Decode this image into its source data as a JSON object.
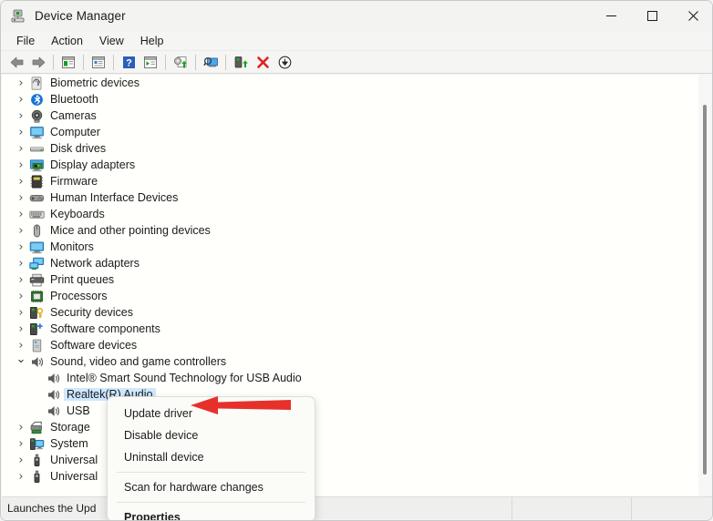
{
  "window": {
    "title": "Device Manager",
    "icon": "device-manager-icon",
    "controls": {
      "minimize": "—",
      "maximize": "☐",
      "close": "✕"
    }
  },
  "menubar": {
    "items": [
      {
        "label": "File"
      },
      {
        "label": "Action"
      },
      {
        "label": "View"
      },
      {
        "label": "Help"
      }
    ]
  },
  "toolbar": {
    "buttons": [
      {
        "name": "back-icon",
        "tip": "Back"
      },
      {
        "name": "forward-icon",
        "tip": "Forward"
      },
      {
        "name": "show-hide-console-tree-icon",
        "tip": "Show/Hide Console Tree"
      },
      {
        "name": "properties-icon",
        "tip": "Properties"
      },
      {
        "name": "help-icon",
        "tip": "Help"
      },
      {
        "name": "scan-list-icon",
        "tip": "Scan"
      },
      {
        "name": "update-driver-icon",
        "tip": "Update driver"
      },
      {
        "name": "scan-hardware-changes-icon",
        "tip": "Scan for hardware changes"
      },
      {
        "name": "enable-device-icon",
        "tip": "Enable device"
      },
      {
        "name": "uninstall-device-icon",
        "tip": "Uninstall device"
      },
      {
        "name": "disable-device-icon",
        "tip": "Disable device"
      }
    ]
  },
  "tree": {
    "items": [
      {
        "label": "Biometric devices",
        "icon": "fingerprint-icon",
        "state": "collapsed",
        "level": 0
      },
      {
        "label": "Bluetooth",
        "icon": "bluetooth-icon",
        "state": "collapsed",
        "level": 0
      },
      {
        "label": "Cameras",
        "icon": "camera-icon",
        "state": "collapsed",
        "level": 0
      },
      {
        "label": "Computer",
        "icon": "computer-icon",
        "state": "collapsed",
        "level": 0
      },
      {
        "label": "Disk drives",
        "icon": "disk-drive-icon",
        "state": "collapsed",
        "level": 0
      },
      {
        "label": "Display adapters",
        "icon": "display-adapter-icon",
        "state": "collapsed",
        "level": 0
      },
      {
        "label": "Firmware",
        "icon": "firmware-icon",
        "state": "collapsed",
        "level": 0
      },
      {
        "label": "Human Interface Devices",
        "icon": "hid-icon",
        "state": "collapsed",
        "level": 0
      },
      {
        "label": "Keyboards",
        "icon": "keyboard-icon",
        "state": "collapsed",
        "level": 0
      },
      {
        "label": "Mice and other pointing devices",
        "icon": "mouse-icon",
        "state": "collapsed",
        "level": 0
      },
      {
        "label": "Monitors",
        "icon": "monitor-icon",
        "state": "collapsed",
        "level": 0
      },
      {
        "label": "Network adapters",
        "icon": "network-adapter-icon",
        "state": "collapsed",
        "level": 0
      },
      {
        "label": "Print queues",
        "icon": "printer-icon",
        "state": "collapsed",
        "level": 0
      },
      {
        "label": "Processors",
        "icon": "processor-icon",
        "state": "collapsed",
        "level": 0
      },
      {
        "label": "Security devices",
        "icon": "security-device-icon",
        "state": "collapsed",
        "level": 0
      },
      {
        "label": "Software components",
        "icon": "software-component-icon",
        "state": "collapsed",
        "level": 0
      },
      {
        "label": "Software devices",
        "icon": "software-device-icon",
        "state": "collapsed",
        "level": 0
      },
      {
        "label": "Sound, video and game controllers",
        "icon": "speaker-icon",
        "state": "expanded",
        "level": 0
      },
      {
        "label": "Intel® Smart Sound Technology for USB Audio",
        "icon": "speaker-icon",
        "state": "leaf",
        "level": 1
      },
      {
        "label": "Realtek(R) Audio",
        "icon": "speaker-icon",
        "state": "leaf",
        "level": 1,
        "selected": true
      },
      {
        "label": "USB",
        "icon": "speaker-icon",
        "state": "leaf",
        "level": 1
      },
      {
        "label": "Storage",
        "icon": "storage-controller-icon",
        "state": "collapsed",
        "level": 0
      },
      {
        "label": "System",
        "icon": "system-device-icon",
        "state": "collapsed",
        "level": 0
      },
      {
        "label": "Universal",
        "icon": "usb-controller-icon",
        "state": "collapsed",
        "level": 0
      },
      {
        "label": "Universal",
        "icon": "usb-controller-icon",
        "state": "collapsed",
        "level": 0
      }
    ]
  },
  "context_menu": {
    "items": [
      {
        "label": "Update driver",
        "bold": false,
        "separator_after": false
      },
      {
        "label": "Disable device",
        "bold": false,
        "separator_after": false
      },
      {
        "label": "Uninstall device",
        "bold": false,
        "separator_after": true
      },
      {
        "label": "Scan for hardware changes",
        "bold": false,
        "separator_after": true
      },
      {
        "label": "Properties",
        "bold": true,
        "separator_after": false
      }
    ]
  },
  "statusbar": {
    "panes": [
      {
        "text": "Launches the Upd"
      },
      {
        "text": ""
      },
      {
        "text": ""
      }
    ]
  },
  "annotation": {
    "arrow_color": "#e8302a",
    "points_to": "Update driver"
  }
}
